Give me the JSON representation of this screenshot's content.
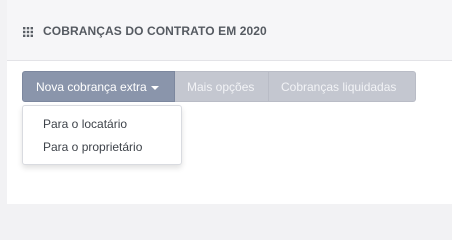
{
  "panel": {
    "title": "COBRANÇAS DO CONTRATO EM 2020",
    "icon": "grid-icon"
  },
  "toolbar": {
    "new_charge_label": "Nova cobrança extra",
    "more_options_label": "Mais opções",
    "settled_charges_label": "Cobranças liquidadas"
  },
  "dropdown": {
    "items": [
      {
        "label": "Para o locatário"
      },
      {
        "label": "Para o proprietário"
      }
    ]
  },
  "colors": {
    "primary_button": "#8a95ab",
    "secondary_button": "#c4c7d0",
    "header_background": "#f6f6f8"
  }
}
